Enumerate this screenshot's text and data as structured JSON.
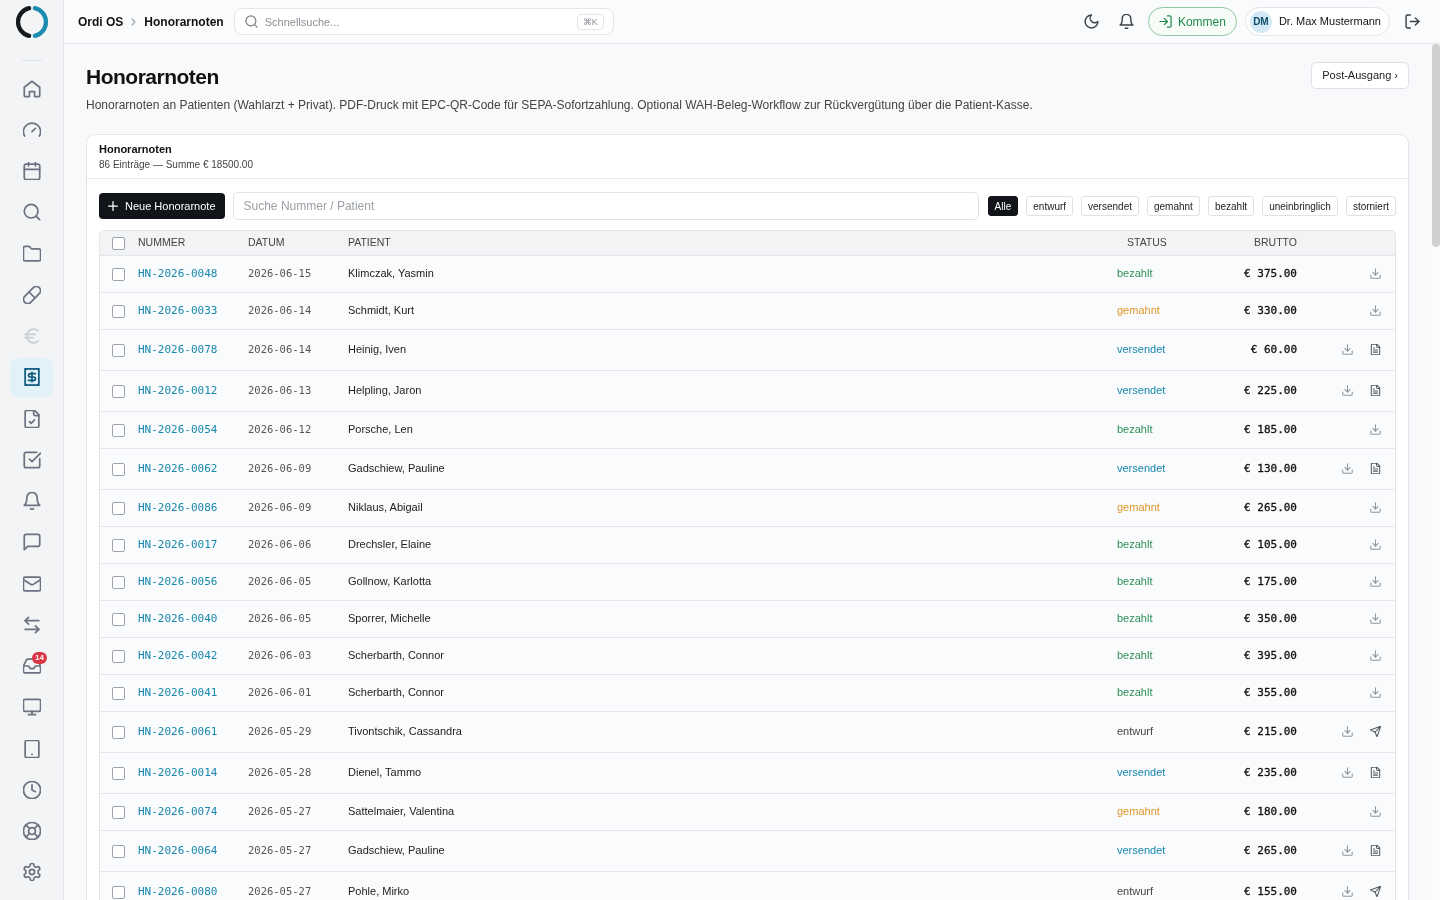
{
  "sidebar": {
    "items": [
      {
        "kind": "house",
        "selected": false,
        "disabled": false
      },
      {
        "kind": "gauge",
        "selected": false,
        "disabled": false
      },
      {
        "kind": "calendar",
        "selected": false,
        "disabled": false
      },
      {
        "kind": "magnifier",
        "selected": false,
        "disabled": false
      },
      {
        "kind": "folder",
        "selected": false,
        "disabled": false
      },
      {
        "kind": "pill",
        "selected": false,
        "disabled": false
      },
      {
        "kind": "euro",
        "selected": false,
        "disabled": true
      },
      {
        "kind": "receipt",
        "selected": true,
        "disabled": false
      },
      {
        "kind": "filecheck",
        "selected": false,
        "disabled": false
      },
      {
        "kind": "checkbox",
        "selected": false,
        "disabled": false
      },
      {
        "kind": "bell",
        "selected": false,
        "disabled": false
      },
      {
        "kind": "chat",
        "selected": false,
        "disabled": false
      },
      {
        "kind": "envelope",
        "selected": false,
        "disabled": false
      },
      {
        "kind": "arrows",
        "selected": false,
        "disabled": false
      },
      {
        "kind": "inbox",
        "selected": false,
        "disabled": false,
        "badge": "14"
      },
      {
        "kind": "monitor",
        "selected": false,
        "disabled": false
      },
      {
        "kind": "tablet",
        "selected": false,
        "disabled": false
      },
      {
        "kind": "clock",
        "selected": false,
        "disabled": false
      },
      {
        "kind": "lifebuoy",
        "selected": false,
        "disabled": false
      },
      {
        "kind": "gear",
        "selected": false,
        "disabled": false
      }
    ]
  },
  "topbar": {
    "breadcrumb": [
      "Ordi OS",
      "Honorarnoten"
    ],
    "search": {
      "placeholder": "Schnellsuche...",
      "shortcut": "⌘K"
    },
    "clock_in_button": "Kommen",
    "user": {
      "initials": "DM",
      "name": "Dr. Max Mustermann"
    }
  },
  "page": {
    "title": "Honorarnoten",
    "description": "Honorarnoten an Patienten (Wahlarzt + Privat). PDF-Druck mit EPC-QR-Code für SEPA-Sofortzahlung. Optional WAH-Beleg-Workflow zur Rückvergütung über die Patient-Kasse.",
    "outbox_button": "Post-Ausgang ›"
  },
  "card": {
    "title": "Honorarnoten",
    "summary": "86 Einträge — Summe € 18500.00",
    "new_button": "Neue Honorarnote",
    "search": {
      "placeholder": "Suche Nummer / Patient"
    },
    "filters": [
      {
        "label": "Alle",
        "selected": true
      },
      {
        "label": "entwurf",
        "selected": false
      },
      {
        "label": "versendet",
        "selected": false
      },
      {
        "label": "gemahnt",
        "selected": false
      },
      {
        "label": "bezahlt",
        "selected": false
      },
      {
        "label": "uneinbringlich",
        "selected": false
      },
      {
        "label": "storniert",
        "selected": false
      }
    ],
    "table": {
      "select_all": {
        "checked": false
      },
      "columns": [
        "NUMMER",
        "DATUM",
        "PATIENT",
        "STATUS",
        "BRUTTO"
      ],
      "rows": [
        {
          "checked": false,
          "number": "HN-2026-0048",
          "date": "2026-06-15",
          "patient": "Klimczak, Yasmin",
          "status": {
            "text": "bezahlt",
            "color": "#2f8f57"
          },
          "amount": "€ 375.00",
          "actions": [
            {
              "kind": "download"
            }
          ]
        },
        {
          "checked": false,
          "number": "HN-2026-0033",
          "date": "2026-06-14",
          "patient": "Schmidt, Kurt",
          "status": {
            "text": "gemahnt",
            "color": "#e0962a"
          },
          "amount": "€ 330.00",
          "actions": [
            {
              "kind": "download"
            }
          ]
        },
        {
          "checked": false,
          "number": "HN-2026-0078",
          "date": "2026-06-14",
          "patient": "Heinig, Iven",
          "status": {
            "text": "versendet",
            "color": "#1787ad"
          },
          "amount": "€ 60.00",
          "actions": [
            {
              "kind": "download"
            },
            {
              "kind": "document"
            }
          ]
        },
        {
          "checked": false,
          "number": "HN-2026-0012",
          "date": "2026-06-13",
          "patient": "Helpling, Jaron",
          "status": {
            "text": "versendet",
            "color": "#1787ad"
          },
          "amount": "€ 225.00",
          "actions": [
            {
              "kind": "download"
            },
            {
              "kind": "document"
            }
          ]
        },
        {
          "checked": false,
          "number": "HN-2026-0054",
          "date": "2026-06-12",
          "patient": "Porsche, Len",
          "status": {
            "text": "bezahlt",
            "color": "#2f8f57"
          },
          "amount": "€ 185.00",
          "actions": [
            {
              "kind": "download"
            }
          ]
        },
        {
          "checked": false,
          "number": "HN-2026-0062",
          "date": "2026-06-09",
          "patient": "Gadschiew, Pauline",
          "status": {
            "text": "versendet",
            "color": "#1787ad"
          },
          "amount": "€ 130.00",
          "actions": [
            {
              "kind": "download"
            },
            {
              "kind": "document"
            }
          ]
        },
        {
          "checked": false,
          "number": "HN-2026-0086",
          "date": "2026-06-09",
          "patient": "Niklaus, Abigail",
          "status": {
            "text": "gemahnt",
            "color": "#e0962a"
          },
          "amount": "€ 265.00",
          "actions": [
            {
              "kind": "download"
            }
          ]
        },
        {
          "checked": false,
          "number": "HN-2026-0017",
          "date": "2026-06-06",
          "patient": "Drechsler, Elaine",
          "status": {
            "text": "bezahlt",
            "color": "#2f8f57"
          },
          "amount": "€ 105.00",
          "actions": [
            {
              "kind": "download"
            }
          ]
        },
        {
          "checked": false,
          "number": "HN-2026-0056",
          "date": "2026-06-05",
          "patient": "Gollnow, Karlotta",
          "status": {
            "text": "bezahlt",
            "color": "#2f8f57"
          },
          "amount": "€ 175.00",
          "actions": [
            {
              "kind": "download"
            }
          ]
        },
        {
          "checked": false,
          "number": "HN-2026-0040",
          "date": "2026-06-05",
          "patient": "Sporrer, Michelle",
          "status": {
            "text": "bezahlt",
            "color": "#2f8f57"
          },
          "amount": "€ 350.00",
          "actions": [
            {
              "kind": "download"
            }
          ]
        },
        {
          "checked": false,
          "number": "HN-2026-0042",
          "date": "2026-06-03",
          "patient": "Scherbarth, Connor",
          "status": {
            "text": "bezahlt",
            "color": "#2f8f57"
          },
          "amount": "€ 395.00",
          "actions": [
            {
              "kind": "download"
            }
          ]
        },
        {
          "checked": false,
          "number": "HN-2026-0041",
          "date": "2026-06-01",
          "patient": "Scherbarth, Connor",
          "status": {
            "text": "bezahlt",
            "color": "#2f8f57"
          },
          "amount": "€ 355.00",
          "actions": [
            {
              "kind": "download"
            }
          ]
        },
        {
          "checked": false,
          "number": "HN-2026-0061",
          "date": "2026-05-29",
          "patient": "Tivontschik, Cassandra",
          "status": {
            "text": "entwurf",
            "color": "#444444"
          },
          "amount": "€ 215.00",
          "actions": [
            {
              "kind": "download"
            },
            {
              "kind": "send"
            }
          ]
        },
        {
          "checked": false,
          "number": "HN-2026-0014",
          "date": "2026-05-28",
          "patient": "Dienel, Tammo",
          "status": {
            "text": "versendet",
            "color": "#1787ad"
          },
          "amount": "€ 235.00",
          "actions": [
            {
              "kind": "download"
            },
            {
              "kind": "document"
            }
          ]
        },
        {
          "checked": false,
          "number": "HN-2026-0074",
          "date": "2026-05-27",
          "patient": "Sattelmaier, Valentina",
          "status": {
            "text": "gemahnt",
            "color": "#e0962a"
          },
          "amount": "€ 180.00",
          "actions": [
            {
              "kind": "download"
            }
          ]
        },
        {
          "checked": false,
          "number": "HN-2026-0064",
          "date": "2026-05-27",
          "patient": "Gadschiew, Pauline",
          "status": {
            "text": "versendet",
            "color": "#1787ad"
          },
          "amount": "€ 265.00",
          "actions": [
            {
              "kind": "download"
            },
            {
              "kind": "document"
            }
          ]
        },
        {
          "checked": false,
          "number": "HN-2026-0080",
          "date": "2026-05-27",
          "patient": "Pohle, Mirko",
          "status": {
            "text": "entwurf",
            "color": "#444444"
          },
          "amount": "€ 155.00",
          "actions": [
            {
              "kind": "download"
            },
            {
              "kind": "send"
            }
          ]
        }
      ]
    }
  }
}
